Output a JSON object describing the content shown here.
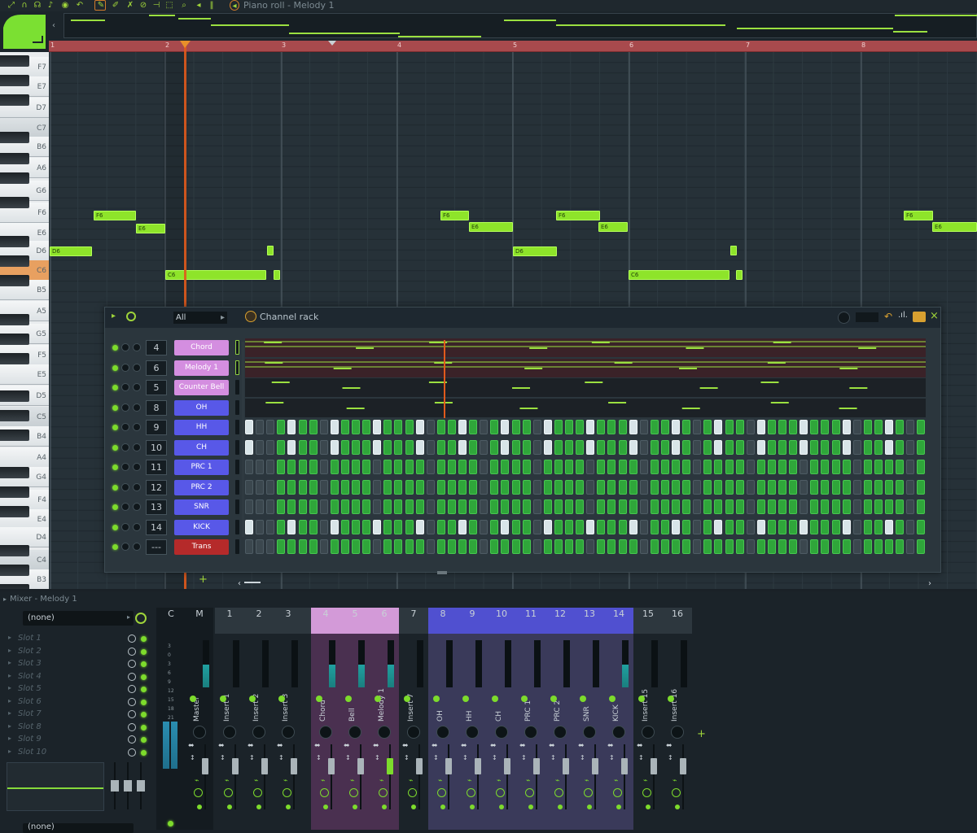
{
  "toolbar": {
    "piano_roll_title": "Piano roll - Melody 1",
    "icons": [
      "magnet-icon",
      "headphones-icon",
      "note-icon",
      "record-icon",
      "undo-icon",
      "pencil-icon",
      "paint-icon",
      "delete-icon",
      "mute-icon",
      "slip-icon",
      "select-icon",
      "zoom-icon",
      "speaker-icon"
    ]
  },
  "timeline": {
    "bars": [
      "1",
      "2",
      "3",
      "4",
      "5",
      "6",
      "7",
      "8"
    ]
  },
  "keys": {
    "labels": [
      "F7",
      "E7",
      "D7",
      "C7",
      "B6",
      "A6",
      "G6",
      "F6",
      "E6",
      "D6",
      "C6",
      "B5",
      "A5",
      "G5",
      "F5",
      "E5",
      "D5",
      "C5",
      "B4",
      "A4",
      "G4",
      "F4",
      "E4",
      "D4",
      "C4",
      "B3"
    ]
  },
  "notes": [
    {
      "label": "D6"
    },
    {
      "label": "F6"
    },
    {
      "label": "E6"
    },
    {
      "label": "C6"
    },
    {
      "label": "F6"
    },
    {
      "label": "E6"
    },
    {
      "label": "D6"
    },
    {
      "label": "F6"
    },
    {
      "label": "E6"
    },
    {
      "label": "C6"
    },
    {
      "label": "F6"
    },
    {
      "label": "E6"
    }
  ],
  "channel_rack": {
    "title": "Channel rack",
    "filter": "All",
    "channels": [
      {
        "num": "4",
        "name": "Chord",
        "color": "#d48ee0"
      },
      {
        "num": "6",
        "name": "Melody 1",
        "color": "#d48ee0"
      },
      {
        "num": "5",
        "name": "Counter Bell",
        "color": "#d48ee0"
      },
      {
        "num": "8",
        "name": "OH",
        "color": "#5858e8"
      },
      {
        "num": "9",
        "name": "HH",
        "color": "#5858e8"
      },
      {
        "num": "10",
        "name": "CH",
        "color": "#5858e8"
      },
      {
        "num": "11",
        "name": "PRC 1",
        "color": "#5858e8"
      },
      {
        "num": "12",
        "name": "PRC 2",
        "color": "#5858e8"
      },
      {
        "num": "13",
        "name": "SNR",
        "color": "#5858e8"
      },
      {
        "num": "14",
        "name": "KICK",
        "color": "#5858e8"
      },
      {
        "num": "---",
        "name": "Trans",
        "color": "#b52a2a"
      }
    ]
  },
  "mixer": {
    "title": "Mixer - Melody 1",
    "preset": "(none)",
    "preset_bottom": "(none)",
    "slots": [
      "Slot 1",
      "Slot 2",
      "Slot 3",
      "Slot 4",
      "Slot 5",
      "Slot 6",
      "Slot 7",
      "Slot 8",
      "Slot 9",
      "Slot 10"
    ],
    "db_scale": [
      "3",
      "0",
      "3",
      "6",
      "9",
      "12",
      "15",
      "18",
      "21"
    ],
    "strips": [
      {
        "num": "C",
        "name": ""
      },
      {
        "num": "M",
        "name": "Master"
      },
      {
        "num": "1",
        "name": "Insert 1"
      },
      {
        "num": "2",
        "name": "Insert 2"
      },
      {
        "num": "3",
        "name": "Insert 3"
      },
      {
        "num": "4",
        "name": "Chord"
      },
      {
        "num": "5",
        "name": "Bell"
      },
      {
        "num": "6",
        "name": "Melody 1"
      },
      {
        "num": "7",
        "name": "Insert 7"
      },
      {
        "num": "8",
        "name": "OH"
      },
      {
        "num": "9",
        "name": "HH"
      },
      {
        "num": "10",
        "name": "CH"
      },
      {
        "num": "11",
        "name": "PRC 1"
      },
      {
        "num": "12",
        "name": "PRC 2"
      },
      {
        "num": "13",
        "name": "SNR"
      },
      {
        "num": "14",
        "name": "KICK"
      },
      {
        "num": "15",
        "name": "Insert 15"
      },
      {
        "num": "16",
        "name": "Insert 16"
      }
    ]
  }
}
